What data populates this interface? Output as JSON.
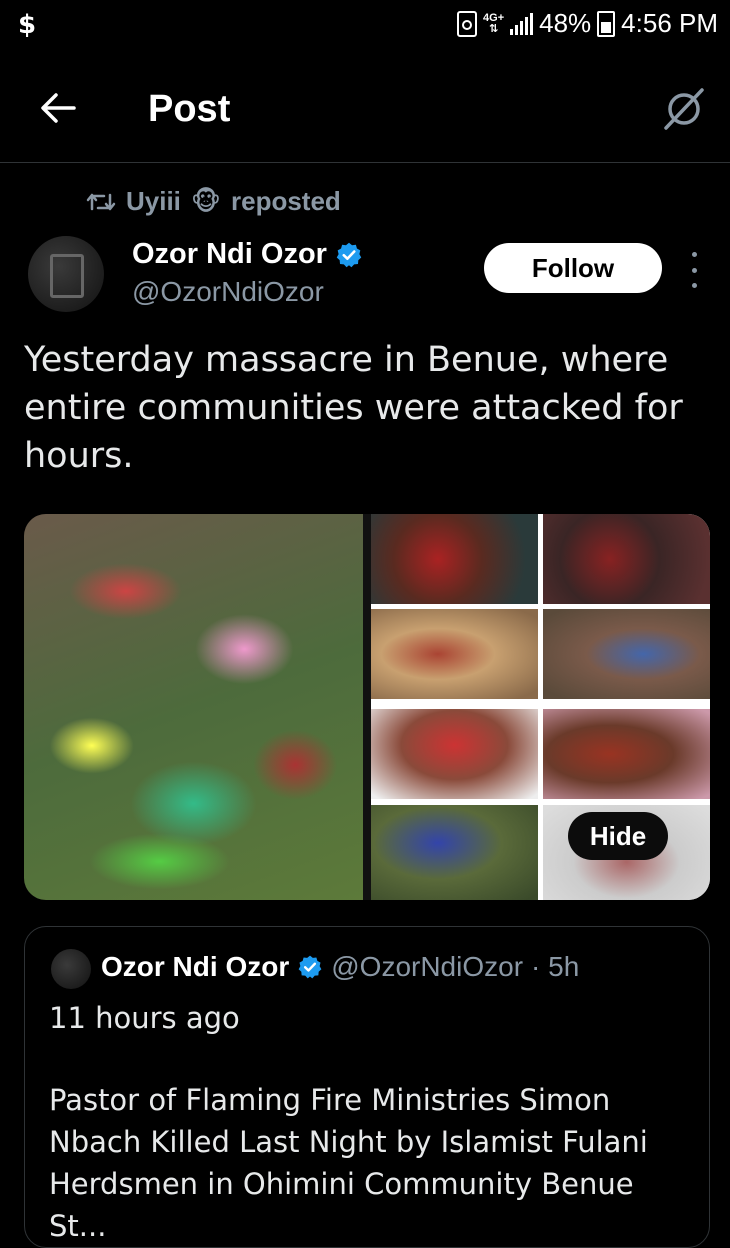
{
  "status_bar": {
    "app_icon": "$",
    "network": "4G+",
    "battery": "48%",
    "time": "4:56 PM"
  },
  "header": {
    "title": "Post",
    "back_icon": "arrow-left-icon",
    "grok_icon": "grok-icon"
  },
  "repost": {
    "reposter": "Uyiii",
    "emoji": "🐵",
    "label": "reposted"
  },
  "post": {
    "author_name": "Ozor Ndi Ozor",
    "handle": "@OzorNdiOzor",
    "follow_label": "Follow",
    "text": "Yesterday massacre in Benue, where entire communities were attacked for hours.",
    "hide_label": "Hide"
  },
  "quoted_post": {
    "author_name": "Ozor Ndi Ozor",
    "handle": "@OzorNdiOzor",
    "time": "· 5h",
    "subtitle": "11 hours ago",
    "text": "Pastor of Flaming Fire Ministries Simon Nbach Killed Last Night by Islamist Fulani Herdsmen in Ohimini Community Benue St..."
  },
  "colors": {
    "background": "#000000",
    "verified": "#1d9bf0",
    "secondary_text": "#8b98a5"
  }
}
